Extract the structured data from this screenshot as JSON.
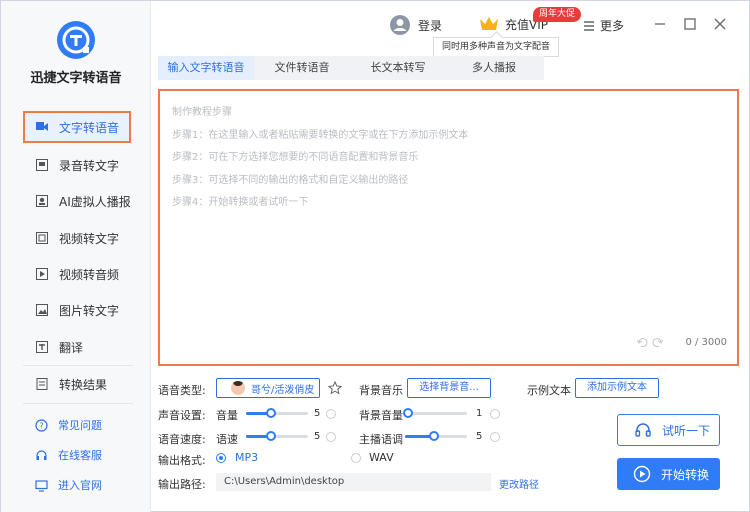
{
  "app": {
    "brand": "迅捷文字转语音"
  },
  "sidebar": {
    "items": [
      {
        "label": "文字转语音",
        "icon": "text-to-speech-icon",
        "active": true
      },
      {
        "label": "录音转文字",
        "icon": "record-icon"
      },
      {
        "label": "AI虚拟人播报",
        "icon": "ai-avatar-icon"
      },
      {
        "label": "视频转文字",
        "icon": "video-text-icon"
      },
      {
        "label": "视频转音频",
        "icon": "video-audio-icon"
      },
      {
        "label": "图片转文字",
        "icon": "image-text-icon"
      },
      {
        "label": "翻译",
        "icon": "translate-icon"
      },
      {
        "label": "转换结果",
        "icon": "result-icon"
      }
    ],
    "help": [
      {
        "label": "常见问题",
        "icon": "question-icon"
      },
      {
        "label": "在线客服",
        "icon": "headset-icon"
      },
      {
        "label": "进入官网",
        "icon": "monitor-icon"
      }
    ]
  },
  "topbar": {
    "login": "登录",
    "vip": "充值VIP",
    "vip_badge": "周年大促",
    "more": "更多",
    "tooltip": "同时用多种声音为文字配音"
  },
  "tabs": [
    "输入文字转语音",
    "文件转语音",
    "长文本转写",
    "多人播报"
  ],
  "editor": {
    "lines": [
      "制作教程步骤",
      "步骤1：在这里输入或者粘贴需要转换的文字或在下方添加示例文本",
      "步骤2：可在下方选择您想要的不同语音配置和背景音乐",
      "步骤3：可选择不同的输出的格式和自定义输出的路径",
      "步骤4：开始转换或者试听一下"
    ],
    "counter": "0 / 3000"
  },
  "settings": {
    "voice_type_label": "语音类型:",
    "voice_name": "哥兮/活泼俏皮",
    "bgm_label": "背景音乐",
    "bgm_button": "选择背景音...",
    "sample_label": "示例文本",
    "sample_button": "添加示例文本",
    "sound_label": "声音设置:",
    "volume_label": "音量",
    "volume_value": "5",
    "bg_volume_label": "背景音量",
    "bg_volume_value": "1",
    "speed_label": "语音速度:",
    "rate_label": "语速",
    "rate_value": "5",
    "tone_label": "主播语调",
    "tone_value": "5",
    "format_label": "输出格式:",
    "format_mp3": "MP3",
    "format_wav": "WAV",
    "path_label": "输出路径:",
    "path_value": "C:\\Users\\Admin\\desktop",
    "change_path": "更改路径",
    "try_button": "试听一下",
    "start_button": "开始转换"
  },
  "colors": {
    "accent": "#2f7cf6",
    "highlight": "#ee7a4a",
    "badge": "#e83b3b"
  }
}
